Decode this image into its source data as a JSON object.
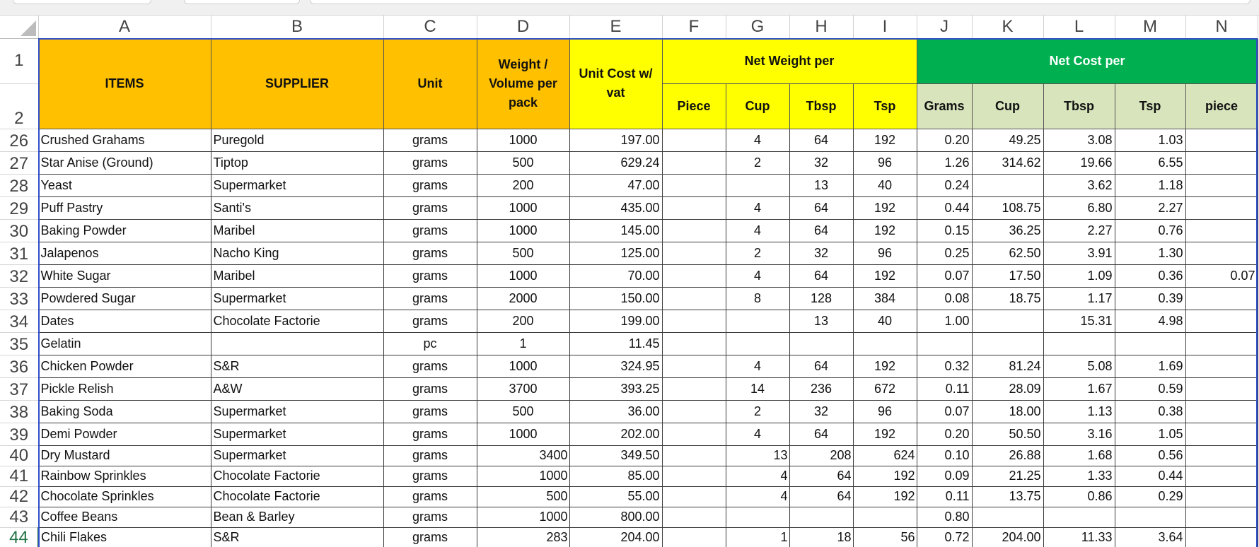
{
  "columns": [
    "A",
    "B",
    "C",
    "D",
    "E",
    "F",
    "G",
    "H",
    "I",
    "J",
    "K",
    "L",
    "M",
    "N"
  ],
  "header_rows": [
    "1",
    "2"
  ],
  "headers": {
    "items": "ITEMS",
    "supplier": "SUPPLIER",
    "unit": "Unit",
    "weight": "Weight / Volume per pack",
    "unit_cost": "Unit Cost w/ vat",
    "net_weight_per": "Net Weight per",
    "net_cost_per": "Net Cost per",
    "piece": "Piece",
    "cup": "Cup",
    "tbsp": "Tbsp",
    "tsp": "Tsp",
    "grams": "Grams",
    "cup2": "Cup",
    "tbsp2": "Tbsp",
    "tsp2": "Tsp",
    "piece2": "piece"
  },
  "colors": {
    "orange": "#ffc000",
    "yellow": "#ffff00",
    "green": "#00b050",
    "light_green": "#d8e4bc",
    "active_row": "#217346"
  },
  "rows": [
    {
      "row": "26",
      "item": "Crushed Grahams",
      "supplier": "Puregold",
      "unit": "grams",
      "weight": "1000",
      "cost": "197.00",
      "piece": "",
      "cup": "4",
      "tbsp": "64",
      "tsp": "192",
      "grams": "0.20",
      "ccup": "49.25",
      "ctbsp": "3.08",
      "ctsp": "1.03",
      "cpiece": ""
    },
    {
      "row": "27",
      "item": "Star Anise (Ground)",
      "supplier": "Tiptop",
      "unit": "grams",
      "weight": "500",
      "cost": "629.24",
      "piece": "",
      "cup": "2",
      "tbsp": "32",
      "tsp": "96",
      "grams": "1.26",
      "ccup": "314.62",
      "ctbsp": "19.66",
      "ctsp": "6.55",
      "cpiece": ""
    },
    {
      "row": "28",
      "item": "Yeast",
      "supplier": "Supermarket",
      "unit": "grams",
      "weight": "200",
      "cost": "47.00",
      "piece": "",
      "cup": "",
      "tbsp": "13",
      "tsp": "40",
      "grams": "0.24",
      "ccup": "",
      "ctbsp": "3.62",
      "ctsp": "1.18",
      "cpiece": ""
    },
    {
      "row": "29",
      "item": "Puff Pastry",
      "supplier": "Santi's",
      "unit": "grams",
      "weight": "1000",
      "cost": "435.00",
      "piece": "",
      "cup": "4",
      "tbsp": "64",
      "tsp": "192",
      "grams": "0.44",
      "ccup": "108.75",
      "ctbsp": "6.80",
      "ctsp": "2.27",
      "cpiece": ""
    },
    {
      "row": "30",
      "item": "Baking Powder",
      "supplier": "Maribel",
      "unit": "grams",
      "weight": "1000",
      "cost": "145.00",
      "piece": "",
      "cup": "4",
      "tbsp": "64",
      "tsp": "192",
      "grams": "0.15",
      "ccup": "36.25",
      "ctbsp": "2.27",
      "ctsp": "0.76",
      "cpiece": ""
    },
    {
      "row": "31",
      "item": "Jalapenos",
      "supplier": "Nacho King",
      "unit": "grams",
      "weight": "500",
      "cost": "125.00",
      "piece": "",
      "cup": "2",
      "tbsp": "32",
      "tsp": "96",
      "grams": "0.25",
      "ccup": "62.50",
      "ctbsp": "3.91",
      "ctsp": "1.30",
      "cpiece": ""
    },
    {
      "row": "32",
      "item": "White Sugar",
      "supplier": "Maribel",
      "unit": "grams",
      "weight": "1000",
      "cost": "70.00",
      "piece": "",
      "cup": "4",
      "tbsp": "64",
      "tsp": "192",
      "grams": "0.07",
      "ccup": "17.50",
      "ctbsp": "1.09",
      "ctsp": "0.36",
      "cpiece": "0.07"
    },
    {
      "row": "33",
      "item": "Powdered Sugar",
      "supplier": "Supermarket",
      "unit": "grams",
      "weight": "2000",
      "cost": "150.00",
      "piece": "",
      "cup": "8",
      "tbsp": "128",
      "tsp": "384",
      "grams": "0.08",
      "ccup": "18.75",
      "ctbsp": "1.17",
      "ctsp": "0.39",
      "cpiece": ""
    },
    {
      "row": "34",
      "item": "Dates",
      "supplier": "Chocolate Factorie",
      "unit": "grams",
      "weight": "200",
      "cost": "199.00",
      "piece": "",
      "cup": "",
      "tbsp": "13",
      "tsp": "40",
      "grams": "1.00",
      "ccup": "",
      "ctbsp": "15.31",
      "ctsp": "4.98",
      "cpiece": ""
    },
    {
      "row": "35",
      "item": "Gelatin",
      "supplier": "",
      "unit": "pc",
      "weight": "1",
      "cost": "11.45",
      "piece": "",
      "cup": "",
      "tbsp": "",
      "tsp": "",
      "grams": "",
      "ccup": "",
      "ctbsp": "",
      "ctsp": "",
      "cpiece": ""
    },
    {
      "row": "36",
      "item": "Chicken Powder",
      "supplier": "S&R",
      "unit": "grams",
      "weight": "1000",
      "cost": "324.95",
      "piece": "",
      "cup": "4",
      "tbsp": "64",
      "tsp": "192",
      "grams": "0.32",
      "ccup": "81.24",
      "ctbsp": "5.08",
      "ctsp": "1.69",
      "cpiece": ""
    },
    {
      "row": "37",
      "item": "Pickle Relish",
      "supplier": "A&W",
      "unit": "grams",
      "weight": "3700",
      "cost": "393.25",
      "piece": "",
      "cup": "14",
      "tbsp": "236",
      "tsp": "672",
      "grams": "0.11",
      "ccup": "28.09",
      "ctbsp": "1.67",
      "ctsp": "0.59",
      "cpiece": ""
    },
    {
      "row": "38",
      "item": "Baking Soda",
      "supplier": "Supermarket",
      "unit": "grams",
      "weight": "500",
      "cost": "36.00",
      "piece": "",
      "cup": "2",
      "tbsp": "32",
      "tsp": "96",
      "grams": "0.07",
      "ccup": "18.00",
      "ctbsp": "1.13",
      "ctsp": "0.38",
      "cpiece": ""
    },
    {
      "row": "39",
      "item": "Demi Powder",
      "supplier": "Supermarket",
      "unit": "grams",
      "weight": "1000",
      "cost": "202.00",
      "piece": "",
      "cup": "4",
      "tbsp": "64",
      "tsp": "192",
      "grams": "0.20",
      "ccup": "50.50",
      "ctbsp": "3.16",
      "ctsp": "1.05",
      "cpiece": ""
    },
    {
      "row": "40",
      "item": "Dry Mustard",
      "supplier": "Supermarket",
      "unit": "grams",
      "weight": "3400",
      "cost": "349.50",
      "piece": "",
      "cup": "13",
      "tbsp": "208",
      "tsp": "624",
      "grams": "0.10",
      "ccup": "26.88",
      "ctbsp": "1.68",
      "ctsp": "0.56",
      "cpiece": "",
      "right": true
    },
    {
      "row": "41",
      "item": "Rainbow Sprinkles",
      "supplier": "Chocolate Factorie",
      "unit": "grams",
      "weight": "1000",
      "cost": "85.00",
      "piece": "",
      "cup": "4",
      "tbsp": "64",
      "tsp": "192",
      "grams": "0.09",
      "ccup": "21.25",
      "ctbsp": "1.33",
      "ctsp": "0.44",
      "cpiece": "",
      "right": true
    },
    {
      "row": "42",
      "item": "Chocolate Sprinkles",
      "supplier": "Chocolate Factorie",
      "unit": "grams",
      "weight": "500",
      "cost": "55.00",
      "piece": "",
      "cup": "4",
      "tbsp": "64",
      "tsp": "192",
      "grams": "0.11",
      "ccup": "13.75",
      "ctbsp": "0.86",
      "ctsp": "0.29",
      "cpiece": "",
      "right": true
    },
    {
      "row": "43",
      "item": "Coffee Beans",
      "supplier": "Bean & Barley",
      "unit": "grams",
      "weight": "1000",
      "cost": "800.00",
      "piece": "",
      "cup": "",
      "tbsp": "",
      "tsp": "",
      "grams": "0.80",
      "ccup": "",
      "ctbsp": "",
      "ctsp": "",
      "cpiece": "",
      "right": true
    },
    {
      "row": "44",
      "item": "Chili Flakes",
      "supplier": "S&R",
      "unit": "grams",
      "weight": "283",
      "cost": "204.00",
      "piece": "",
      "cup": "1",
      "tbsp": "18",
      "tsp": "56",
      "grams": "0.72",
      "ccup": "204.00",
      "ctbsp": "11.33",
      "ctsp": "3.64",
      "cpiece": "",
      "right": true,
      "active": true
    }
  ]
}
